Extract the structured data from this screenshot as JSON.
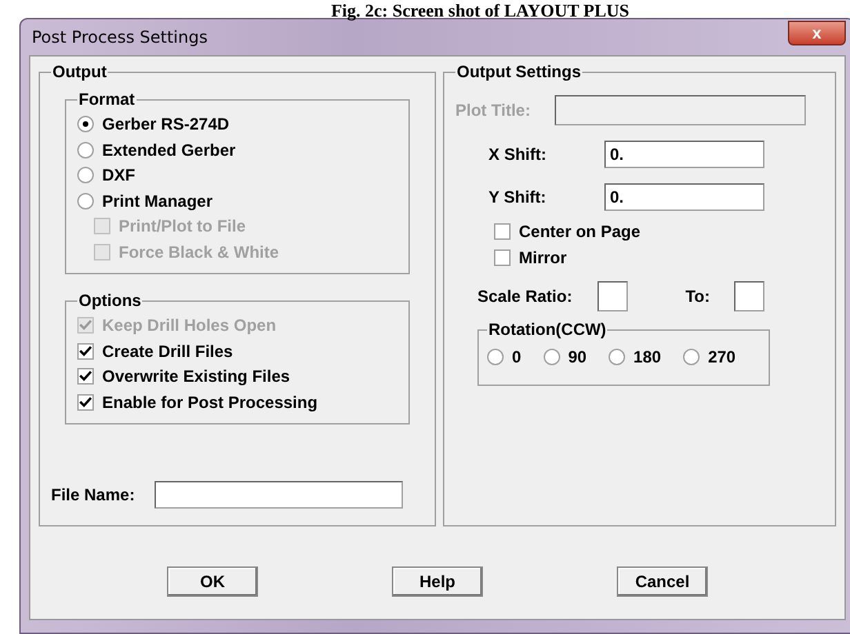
{
  "caption": "Fig. 2c: Screen shot of LAYOUT PLUS",
  "window": {
    "title": "Post Process Settings",
    "close": "x"
  },
  "output": {
    "title": "Output",
    "format": {
      "title": "Format",
      "radios": [
        {
          "label": "Gerber RS-274D",
          "selected": true
        },
        {
          "label": "Extended Gerber",
          "selected": false
        },
        {
          "label": "DXF",
          "selected": false
        },
        {
          "label": "Print Manager",
          "selected": false
        }
      ],
      "checks": [
        {
          "label": "Print/Plot to File",
          "checked": false,
          "disabled": true
        },
        {
          "label": "Force Black & White",
          "checked": false,
          "disabled": true
        }
      ]
    },
    "options": {
      "title": "Options",
      "checks": [
        {
          "label": "Keep Drill Holes Open",
          "checked": true,
          "disabled": true
        },
        {
          "label": "Create Drill Files",
          "checked": true,
          "disabled": false
        },
        {
          "label": "Overwrite Existing Files",
          "checked": true,
          "disabled": false
        },
        {
          "label": "Enable for Post Processing",
          "checked": true,
          "disabled": false
        }
      ]
    },
    "file_name": {
      "label": "File Name:"
    }
  },
  "settings": {
    "title": "Output Settings",
    "plot_title": {
      "label": "Plot Title:",
      "disabled": true
    },
    "x_shift": {
      "label": "X Shift:",
      "value": "0."
    },
    "y_shift": {
      "label": "Y Shift:",
      "value": "0."
    },
    "checks": [
      {
        "label": "Center on Page",
        "checked": false
      },
      {
        "label": "Mirror",
        "checked": false
      }
    ],
    "scale_ratio": {
      "label": "Scale Ratio:"
    },
    "to": {
      "label": "To:"
    },
    "rotation": {
      "title": "Rotation(CCW)",
      "radios": [
        {
          "label": "0",
          "selected": false
        },
        {
          "label": "90",
          "selected": false
        },
        {
          "label": "180",
          "selected": false
        },
        {
          "label": "270",
          "selected": false
        }
      ]
    }
  },
  "buttons": [
    "OK",
    "Help",
    "Cancel"
  ]
}
